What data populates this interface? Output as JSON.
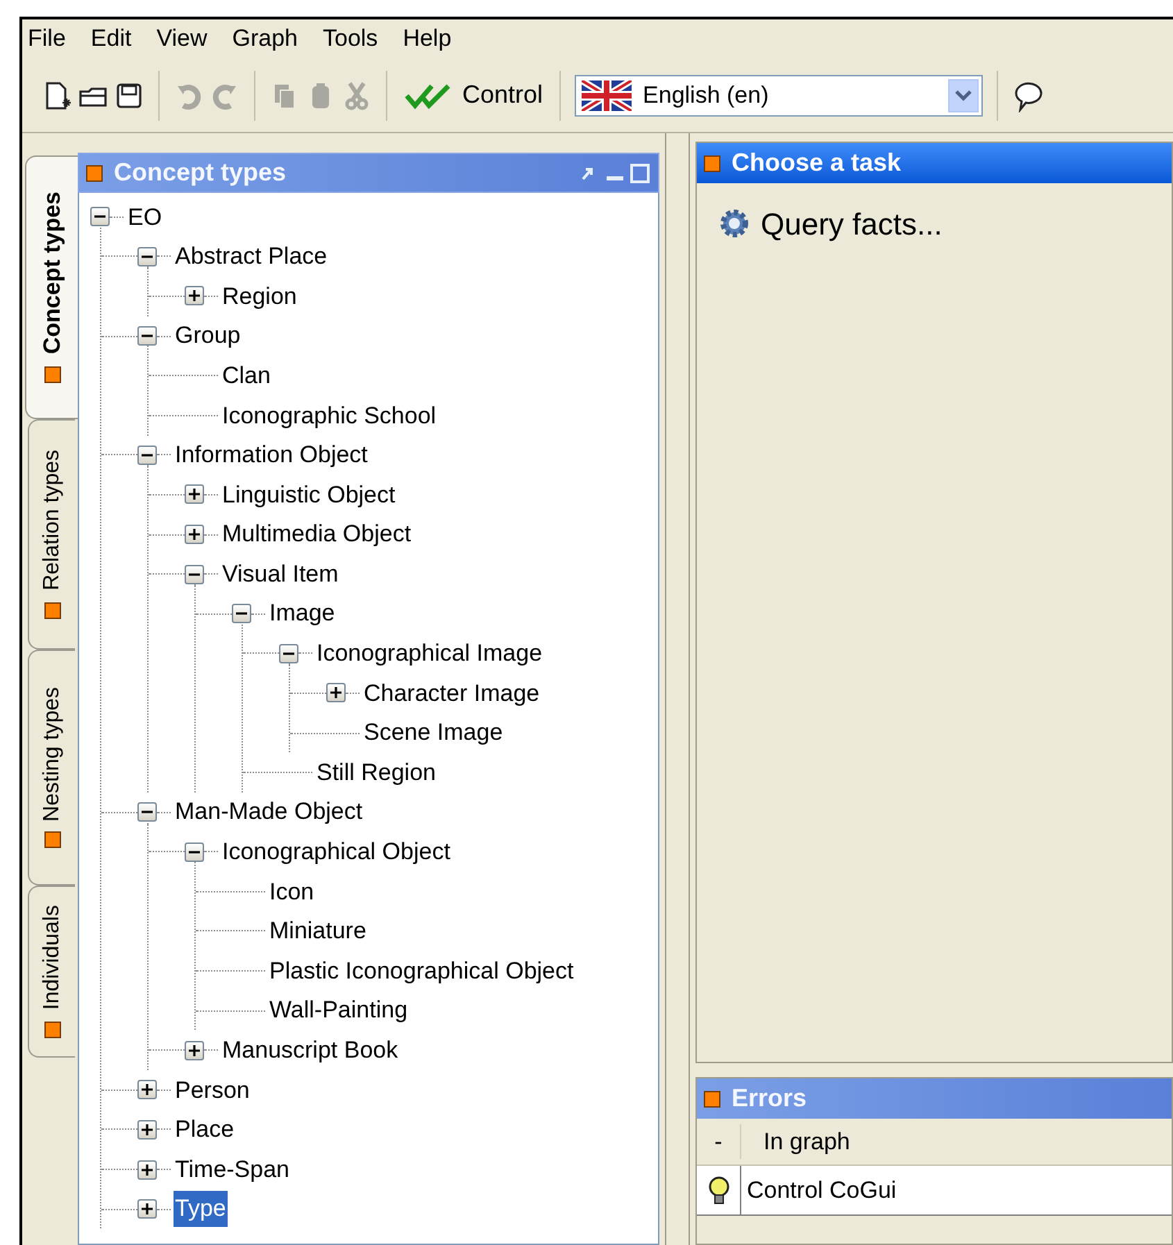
{
  "menu": [
    "File",
    "Edit",
    "View",
    "Graph",
    "Tools",
    "Help"
  ],
  "toolbar": [
    {
      "kind": "new",
      "disabled": false
    },
    {
      "kind": "open",
      "disabled": false
    },
    {
      "kind": "save",
      "disabled": false
    },
    {
      "kind": "sep"
    },
    {
      "kind": "undo",
      "disabled": true
    },
    {
      "kind": "redo",
      "disabled": true
    },
    {
      "kind": "sep"
    },
    {
      "kind": "copy",
      "disabled": true
    },
    {
      "kind": "paste",
      "disabled": true
    },
    {
      "kind": "cut",
      "disabled": true
    },
    {
      "kind": "sep"
    }
  ],
  "control_button": "Control",
  "language": "English (en)",
  "side_tabs": [
    {
      "label": "Concept types",
      "selected": true
    },
    {
      "label": "Relation types",
      "selected": false
    },
    {
      "label": "Nesting types",
      "selected": false
    },
    {
      "label": "Individuals",
      "selected": false
    }
  ],
  "concept_panel": {
    "title": "Concept types",
    "tree": [
      {
        "label": "EO",
        "kind": "branch",
        "expanded": true,
        "selected": false,
        "children": [
          {
            "label": "Abstract Place",
            "kind": "branch",
            "expanded": true,
            "selected": false,
            "children": [
              {
                "label": "Region",
                "kind": "branch",
                "expanded": false,
                "selected": false
              }
            ]
          },
          {
            "label": "Group",
            "kind": "branch",
            "expanded": true,
            "selected": false,
            "children": [
              {
                "label": "Clan",
                "kind": "leaf",
                "selected": false
              },
              {
                "label": "Iconographic School",
                "kind": "leaf",
                "selected": false
              }
            ]
          },
          {
            "label": "Information Object",
            "kind": "branch",
            "expanded": true,
            "selected": false,
            "children": [
              {
                "label": "Linguistic Object",
                "kind": "branch",
                "expanded": false,
                "selected": false
              },
              {
                "label": "Multimedia Object",
                "kind": "branch",
                "expanded": false,
                "selected": false
              },
              {
                "label": "Visual Item",
                "kind": "branch",
                "expanded": true,
                "selected": false,
                "children": [
                  {
                    "label": "Image",
                    "kind": "branch",
                    "expanded": true,
                    "selected": false,
                    "children": [
                      {
                        "label": "Iconographical Image",
                        "kind": "branch",
                        "expanded": true,
                        "selected": false,
                        "children": [
                          {
                            "label": "Character Image",
                            "kind": "branch",
                            "expanded": false,
                            "selected": false
                          },
                          {
                            "label": "Scene Image",
                            "kind": "leaf",
                            "selected": false
                          }
                        ]
                      },
                      {
                        "label": "Still Region",
                        "kind": "leaf",
                        "selected": false
                      }
                    ]
                  }
                ]
              }
            ]
          },
          {
            "label": "Man-Made Object",
            "kind": "branch",
            "expanded": true,
            "selected": false,
            "children": [
              {
                "label": "Iconographical Object",
                "kind": "branch",
                "expanded": true,
                "selected": false,
                "children": [
                  {
                    "label": "Icon",
                    "kind": "leaf",
                    "selected": false
                  },
                  {
                    "label": "Miniature",
                    "kind": "leaf",
                    "selected": false
                  },
                  {
                    "label": "Plastic Iconographical Object",
                    "kind": "leaf",
                    "selected": false
                  },
                  {
                    "label": "Wall-Painting",
                    "kind": "leaf",
                    "selected": false
                  }
                ]
              },
              {
                "label": "Manuscript Book",
                "kind": "branch",
                "expanded": false,
                "selected": false
              }
            ]
          },
          {
            "label": "Person",
            "kind": "branch",
            "expanded": false,
            "selected": false
          },
          {
            "label": "Place",
            "kind": "branch",
            "expanded": false,
            "selected": false
          },
          {
            "label": "Time-Span",
            "kind": "branch",
            "expanded": false,
            "selected": false
          },
          {
            "label": "Type",
            "kind": "branch",
            "expanded": false,
            "selected": true
          }
        ]
      }
    ]
  },
  "task_panel": {
    "title": "Choose a task",
    "tasks": [
      "Query facts..."
    ]
  },
  "errors_panel": {
    "title": "Errors",
    "columns": [
      "-",
      "In graph"
    ],
    "rows": [
      {
        "message": "Control CoGui"
      }
    ]
  }
}
